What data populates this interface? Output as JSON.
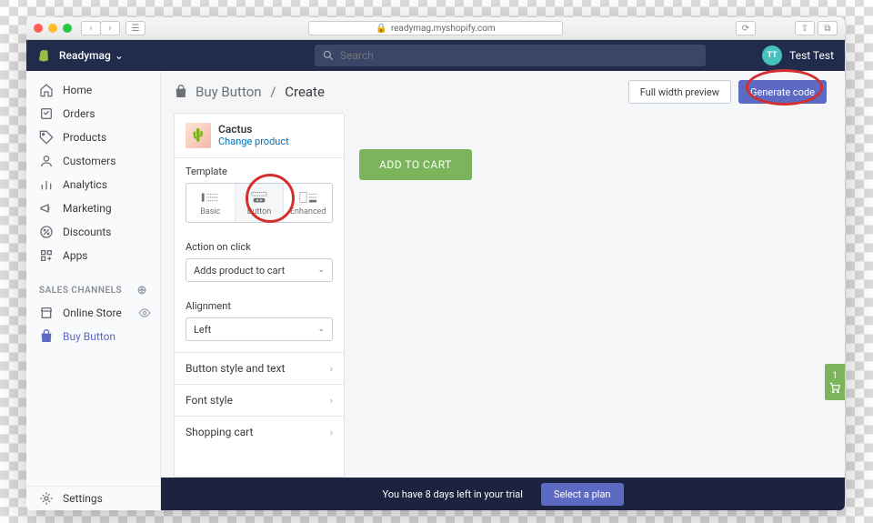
{
  "browser": {
    "url": "readymag.myshopify.com"
  },
  "topbar": {
    "shop_name": "Readymag",
    "search_placeholder": "Search",
    "user_initials": "TT",
    "user_name": "Test Test"
  },
  "sidebar": {
    "items": [
      {
        "label": "Home"
      },
      {
        "label": "Orders"
      },
      {
        "label": "Products"
      },
      {
        "label": "Customers"
      },
      {
        "label": "Analytics"
      },
      {
        "label": "Marketing"
      },
      {
        "label": "Discounts"
      },
      {
        "label": "Apps"
      }
    ],
    "channels_header": "SALES CHANNELS",
    "channels": [
      {
        "label": "Online Store"
      },
      {
        "label": "Buy Button"
      }
    ],
    "settings_label": "Settings"
  },
  "page": {
    "breadcrumb_link": "Buy Button",
    "breadcrumb_current": "Create",
    "full_width_label": "Full width preview",
    "generate_label": "Generate code"
  },
  "config": {
    "product_name": "Cactus",
    "change_product": "Change product",
    "template_label": "Template",
    "templates": [
      {
        "label": "Basic"
      },
      {
        "label": "Button"
      },
      {
        "label": "Enhanced"
      }
    ],
    "action_label": "Action on click",
    "action_value": "Adds product to cart",
    "alignment_label": "Alignment",
    "alignment_value": "Left",
    "expand_rows": [
      "Button style and text",
      "Font style",
      "Shopping cart"
    ]
  },
  "preview": {
    "add_to_cart": "ADD TO CART"
  },
  "trial": {
    "message": "You have 8 days left in your trial",
    "select_plan": "Select a plan"
  },
  "fab": {
    "count": "1"
  }
}
